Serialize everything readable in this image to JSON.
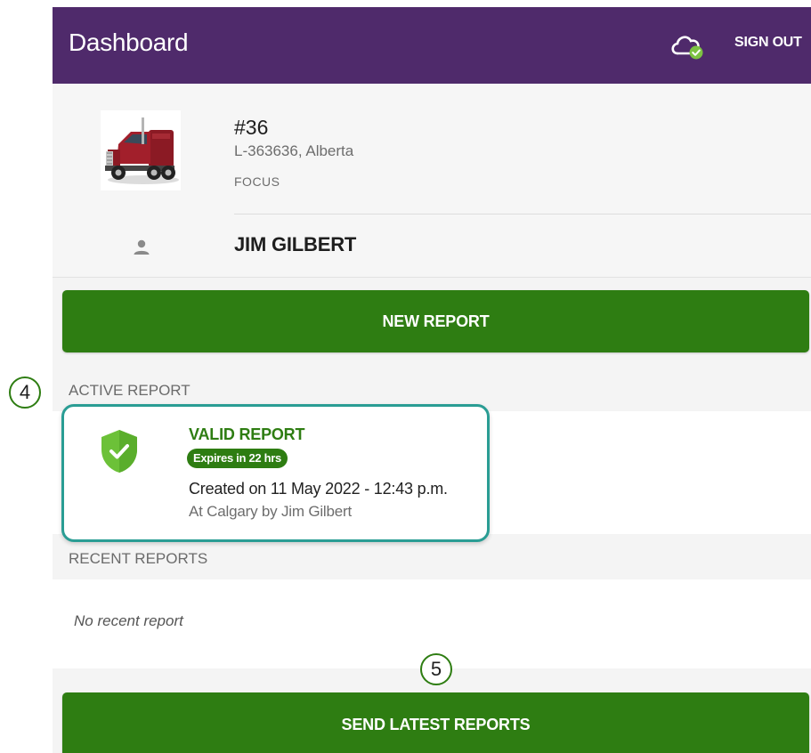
{
  "header": {
    "title": "Dashboard",
    "sync_icon": "cloud-check-icon",
    "sign_out_label": "SIGN OUT",
    "color": "#4f2a6b"
  },
  "vehicle": {
    "image_icon": "truck-image",
    "number": "#36",
    "plate": "L-363636, Alberta",
    "model": "FOCUS"
  },
  "driver": {
    "icon": "person-icon",
    "name": "JIM GILBERT"
  },
  "actions": {
    "new_report_label": "NEW REPORT",
    "send_reports_label": "SEND LATEST REPORTS",
    "accent_color": "#2e7d12"
  },
  "active_report": {
    "section_label": "ACTIVE REPORT",
    "status_icon": "shield-check-icon",
    "status": "VALID REPORT",
    "expires": "Expires in 22 hrs",
    "created": "Created on 11 May 2022 - 12:43 p.m.",
    "location": "At Calgary by Jim Gilbert",
    "outline_color": "#2a9d94"
  },
  "recent_reports": {
    "section_label": "RECENT REPORTS",
    "empty_text": "No recent report"
  },
  "annotations": {
    "step_4": "4",
    "step_5": "5"
  }
}
